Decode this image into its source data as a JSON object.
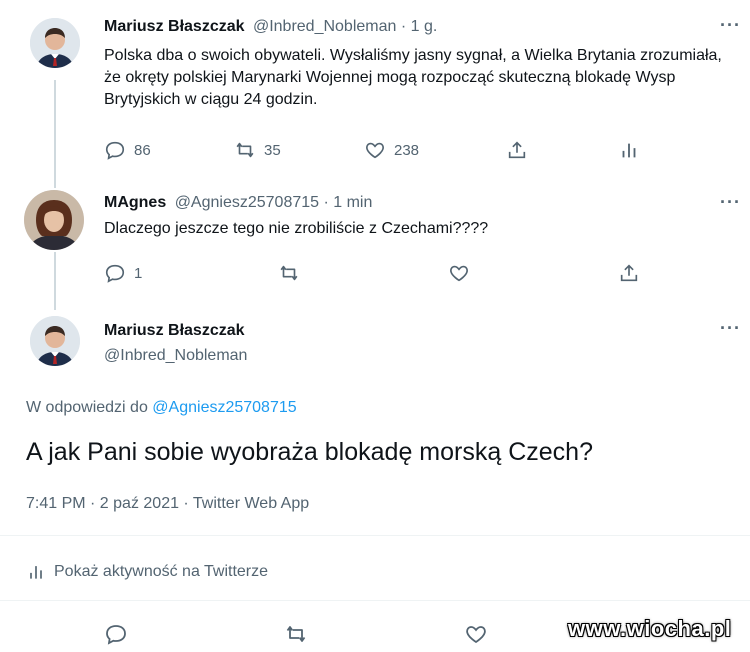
{
  "tweet1": {
    "name": "Mariusz Błaszczak",
    "handle_time": "@Inbred_Nobleman · 1 g.",
    "text": "Polska dba o swoich obywateli. Wysłaliśmy jasny sygnał, a Wielka Brytania zrozumiała, że okręty polskiej Marynarki Wojennej mogą rozpocząć skuteczną blokadę Wysp Brytyjskich w ciągu 24 godzin.",
    "reply_count": "86",
    "retweet_count": "35",
    "like_count": "238"
  },
  "tweet2": {
    "name": "MAgnes",
    "handle_time": "@Agniesz25708715 · 1 min",
    "text": "Dlaczego jeszcze tego nie zrobiliście z Czechami????",
    "reply_count": "1"
  },
  "tweet3": {
    "name": "Mariusz Błaszczak",
    "handle": "@Inbred_Nobleman",
    "reply_to_prefix": "W odpowiedzi do",
    "reply_to_handle": "@Agniesz25708715",
    "text": "A jak Pani sobie wyobraża blokadę morską Czech?",
    "meta": "7:41 PM · 2 paź 2021 · Twitter Web App",
    "activity": "Pokaż aktywność na Twitterze"
  },
  "more_glyph": "···",
  "watermark": "www.wiocha.pl",
  "colors": {
    "accent": "#1d9bf0",
    "muted": "#536471",
    "text": "#0f1419"
  }
}
